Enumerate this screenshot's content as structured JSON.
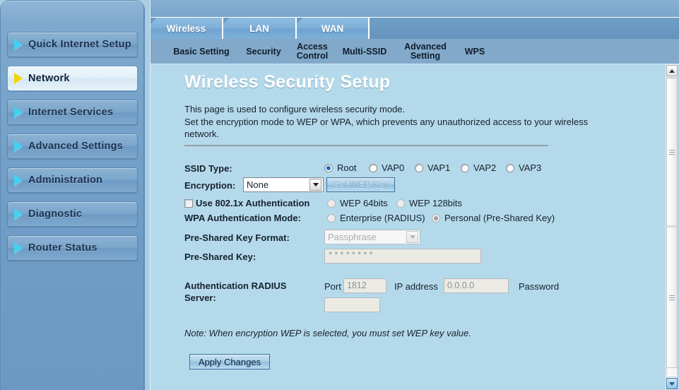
{
  "sidebar": {
    "items": [
      {
        "label": "Quick Internet Setup",
        "active": false
      },
      {
        "label": "Network",
        "active": true
      },
      {
        "label": "Internet Services",
        "active": false
      },
      {
        "label": "Advanced Settings",
        "active": false
      },
      {
        "label": "Administration",
        "active": false
      },
      {
        "label": "Diagnostic",
        "active": false
      },
      {
        "label": "Router Status",
        "active": false
      }
    ]
  },
  "tabs": [
    {
      "label": "Wireless"
    },
    {
      "label": "LAN"
    },
    {
      "label": "WAN"
    }
  ],
  "subtabs": [
    {
      "label": "Basic Setting"
    },
    {
      "label": "Security"
    },
    {
      "label": "Access Control"
    },
    {
      "label": "Multi-SSID"
    },
    {
      "label": "Advanced Setting"
    },
    {
      "label": "WPS"
    }
  ],
  "page": {
    "title": "Wireless Security Setup",
    "description_line1": "This page is used to configure wireless security mode.",
    "description_line2": "Set the encryption mode to WEP or WPA, which prevents any unauthorized access to your wireless network."
  },
  "form": {
    "ssid_type_label": "SSID Type:",
    "ssid_options": [
      {
        "label": "Root",
        "selected": true
      },
      {
        "label": "VAP0",
        "selected": false
      },
      {
        "label": "VAP1",
        "selected": false
      },
      {
        "label": "VAP2",
        "selected": false
      },
      {
        "label": "VAP3",
        "selected": false
      }
    ],
    "encryption_label": "Encryption:",
    "encryption_value": "None",
    "set_wep_key_label": "Set WEP Key",
    "use_8021x_label": "Use 802.1x Authentication",
    "wep_64_label": "WEP 64bits",
    "wep_128_label": "WEP 128bits",
    "wpa_auth_mode_label": "WPA Authentication Mode:",
    "wpa_enterprise_label": "Enterprise (RADIUS)",
    "wpa_personal_label": "Personal (Pre-Shared Key)",
    "psk_format_label": "Pre-Shared Key Format:",
    "psk_format_value": "Passphrase",
    "psk_label": "Pre-Shared Key:",
    "psk_value": "********",
    "radius_label_line1": "Authentication RADIUS",
    "radius_label_line2": "Server:",
    "radius_port_label": "Port",
    "radius_port_value": "1812",
    "radius_ip_label": "IP address",
    "radius_ip_value": "0.0.0.0",
    "radius_password_label": "Password",
    "radius_password_value": "",
    "note": "Note: When encryption WEP is selected, you must set WEP key value.",
    "apply_label": "Apply Changes"
  },
  "colors": {
    "content_bg": "#b4d9ea",
    "sidebar_bg": "#7ba6cb",
    "accent": "#41d2f2",
    "active_marker": "#f2d400"
  }
}
